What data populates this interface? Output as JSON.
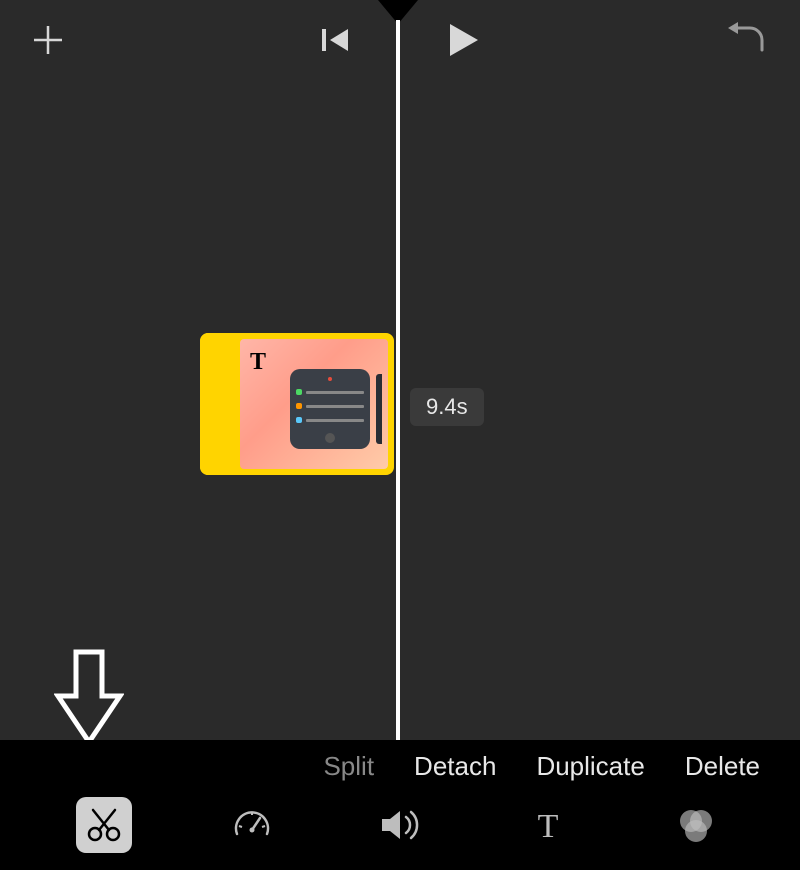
{
  "topbar": {
    "add_icon": "plus-icon",
    "prev_icon": "skip-back-icon",
    "play_icon": "play-icon",
    "undo_icon": "undo-icon"
  },
  "timeline": {
    "selected_clip": {
      "has_title_overlay": true,
      "title_glyph": "T"
    },
    "duration_label": "9.4s"
  },
  "actions": {
    "split": "Split",
    "detach": "Detach",
    "duplicate": "Duplicate",
    "delete": "Delete"
  },
  "tools": {
    "cut": "cut",
    "speed": "speed",
    "volume": "volume",
    "text": "text",
    "filters": "filters",
    "active": "cut"
  }
}
